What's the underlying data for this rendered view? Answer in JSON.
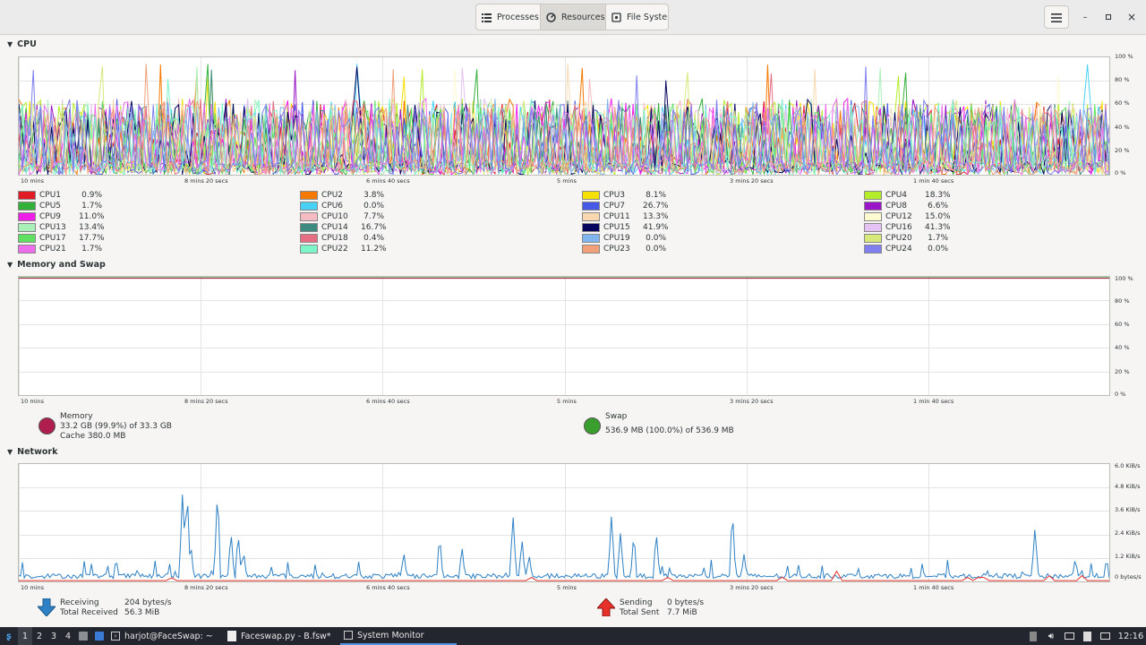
{
  "header": {
    "tabs": [
      {
        "label": "Processes",
        "icon": "list-icon"
      },
      {
        "label": "Resources",
        "icon": "gauge-icon",
        "active": true
      },
      {
        "label": "File Systems",
        "icon": "disk-icon"
      }
    ]
  },
  "cpu": {
    "title": "CPU",
    "xlabels": [
      "10 mins",
      "8 mins 20 secs",
      "6 mins 40 secs",
      "5 mins",
      "3 mins 20 secs",
      "1 min 40 secs"
    ],
    "ylabels": [
      "100 %",
      "80 %",
      "60 %",
      "40 %",
      "20 %",
      "0 %"
    ],
    "cores": [
      {
        "name": "CPU1",
        "value": "0.9%",
        "color": "#e01b24"
      },
      {
        "name": "CPU2",
        "value": "3.8%",
        "color": "#f57900"
      },
      {
        "name": "CPU3",
        "value": "8.1%",
        "color": "#f5e000"
      },
      {
        "name": "CPU4",
        "value": "18.3%",
        "color": "#b4ec29"
      },
      {
        "name": "CPU5",
        "value": "1.7%",
        "color": "#33b03a"
      },
      {
        "name": "CPU6",
        "value": "0.0%",
        "color": "#48d1f5"
      },
      {
        "name": "CPU7",
        "value": "26.7%",
        "color": "#4758e6"
      },
      {
        "name": "CPU8",
        "value": "6.6%",
        "color": "#9a14c8"
      },
      {
        "name": "CPU9",
        "value": "11.0%",
        "color": "#f01ee9"
      },
      {
        "name": "CPU10",
        "value": "7.7%",
        "color": "#f5bcc3"
      },
      {
        "name": "CPU11",
        "value": "13.3%",
        "color": "#f7d8b0"
      },
      {
        "name": "CPU12",
        "value": "15.0%",
        "color": "#fdfad2"
      },
      {
        "name": "CPU13",
        "value": "13.4%",
        "color": "#a8f0b8"
      },
      {
        "name": "CPU14",
        "value": "16.7%",
        "color": "#3f8a80"
      },
      {
        "name": "CPU15",
        "value": "41.9%",
        "color": "#06065e"
      },
      {
        "name": "CPU16",
        "value": "41.3%",
        "color": "#e4c2f3"
      },
      {
        "name": "CPU17",
        "value": "17.7%",
        "color": "#5ee060"
      },
      {
        "name": "CPU18",
        "value": "0.4%",
        "color": "#e56e82"
      },
      {
        "name": "CPU19",
        "value": "0.0%",
        "color": "#7fb6ef"
      },
      {
        "name": "CPU20",
        "value": "1.7%",
        "color": "#d5ea7a"
      },
      {
        "name": "CPU21",
        "value": "1.7%",
        "color": "#ec6cea"
      },
      {
        "name": "CPU22",
        "value": "11.2%",
        "color": "#7df5c8"
      },
      {
        "name": "CPU23",
        "value": "0.0%",
        "color": "#f1a07a"
      },
      {
        "name": "CPU24",
        "value": "0.0%",
        "color": "#7f7ff0"
      }
    ]
  },
  "memory": {
    "title": "Memory and Swap",
    "xlabels": [
      "10 mins",
      "8 mins 20 secs",
      "6 mins 40 secs",
      "5 mins",
      "3 mins 20 secs",
      "1 min 40 secs"
    ],
    "ylabels": [
      "100 %",
      "80 %",
      "60 %",
      "40 %",
      "20 %",
      "0 %"
    ],
    "mem_label": "Memory",
    "mem_usage": "33.2 GB (99.9%) of 33.3 GB",
    "mem_cache": "Cache 380.0 MB",
    "mem_color": "#b01e50",
    "swap_label": "Swap",
    "swap_usage": "536.9 MB (100.0%) of 536.9 MB",
    "swap_color": "#3a9e2f",
    "mem_percent": 99.9,
    "swap_percent": 100.0
  },
  "network": {
    "title": "Network",
    "xlabels": [
      "10 mins",
      "8 mins 20 secs",
      "6 mins 40 secs",
      "5 mins",
      "3 mins 20 secs",
      "1 min 40 secs"
    ],
    "ylabels": [
      "6.0 KiB/s",
      "4.8 KiB/s",
      "3.6 KiB/s",
      "2.4 KiB/s",
      "1.2 KiB/s",
      "0 bytes/s"
    ],
    "receiving_label": "Receiving",
    "receiving_value": "204 bytes/s",
    "total_received_label": "Total Received",
    "total_received_value": "56.3 MiB",
    "sending_label": "Sending",
    "sending_value": "0 bytes/s",
    "total_sent_label": "Total Sent",
    "total_sent_value": "7.7 MiB",
    "recv_color": "#2e81c4",
    "send_color": "#e8302a"
  },
  "taskbar": {
    "workspaces": [
      "1",
      "2",
      "3",
      "4"
    ],
    "windows": [
      {
        "label": "harjot@FaceSwap: ~",
        "icon": "terminal-icon"
      },
      {
        "label": "Faceswap.py - B.fsw*",
        "icon": "python-icon"
      },
      {
        "label": "System Monitor",
        "icon": "monitor-icon",
        "active": true
      }
    ],
    "clock": "12:16"
  }
}
